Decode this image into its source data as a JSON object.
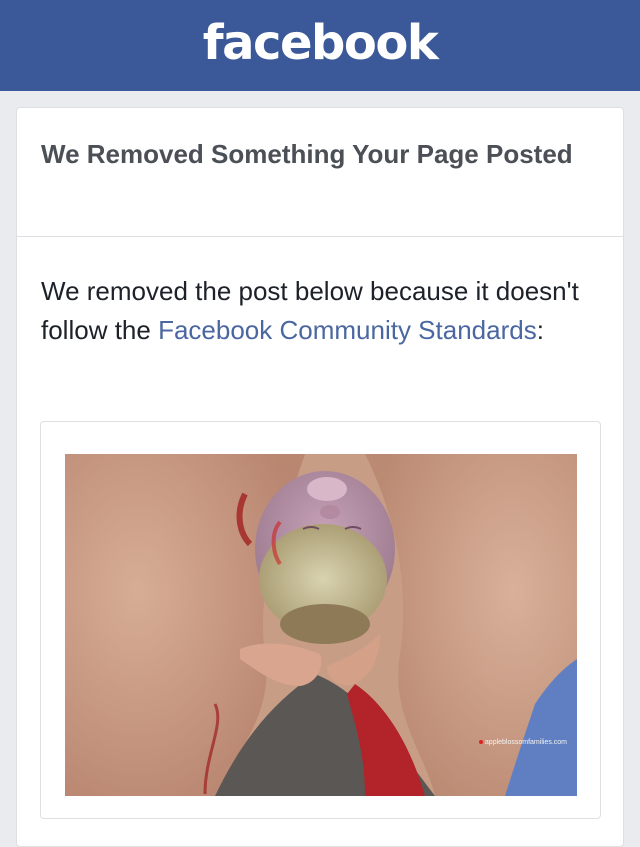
{
  "app": {
    "logo_text": "facebook",
    "brand_color": "#3b5998"
  },
  "notice": {
    "title": "We Removed Something Your Page Posted",
    "message_before_link": "We removed the post below because it doesn't follow the ",
    "link_text": "Facebook Community Standards",
    "message_after_link": ":"
  },
  "post": {
    "image_watermark": "appleblossomfamilies.com",
    "image_subject": "photograph-of-childbirth"
  }
}
